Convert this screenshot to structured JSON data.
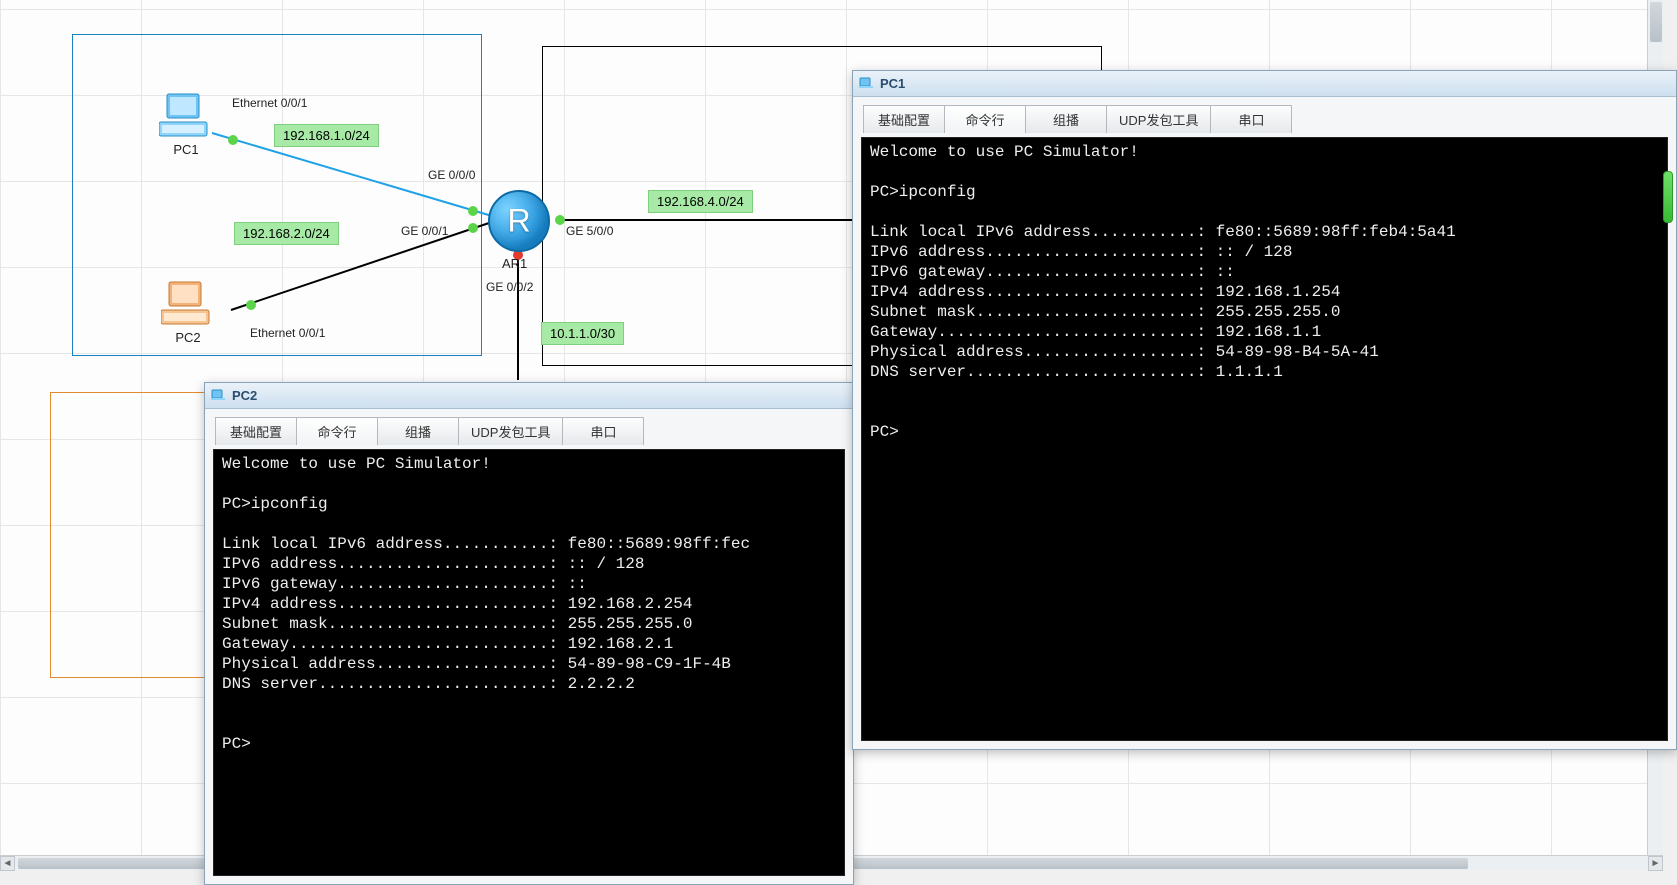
{
  "topology": {
    "devices": {
      "pc1": {
        "label": "PC1",
        "port": "Ethernet 0/0/1"
      },
      "pc2": {
        "label": "PC2",
        "port": "Ethernet 0/0/1"
      },
      "ar1": {
        "label": "AR1"
      }
    },
    "router_ports": {
      "ge000": "GE 0/0/0",
      "ge001": "GE 0/0/1",
      "ge002": "GE 0/0/2",
      "ge500": "GE 5/0/0"
    },
    "subnets": {
      "net1": "192.168.1.0/24",
      "net2": "192.168.2.0/24",
      "net4": "192.168.4.0/24",
      "net_p2p": "10.1.1.0/30"
    }
  },
  "tabs": {
    "basic": "基础配置",
    "cli": "命令行",
    "mcast": "组播",
    "udp": "UDP发包工具",
    "serial": "串口"
  },
  "pc1_window": {
    "title": "PC1",
    "terminal": {
      "welcome": "Welcome to use PC Simulator!",
      "prompt1": "PC>ipconfig",
      "line_linklocal": "Link local IPv6 address...........: fe80::5689:98ff:feb4:5a41",
      "line_v6addr": "IPv6 address......................: :: / 128",
      "line_v6gw": "IPv6 gateway......................: ::",
      "line_v4addr": "IPv4 address......................: 192.168.1.254",
      "line_mask": "Subnet mask.......................: 255.255.255.0",
      "line_gw": "Gateway...........................: 192.168.1.1",
      "line_mac": "Physical address..................: 54-89-98-B4-5A-41",
      "line_dns": "DNS server........................: 1.1.1.1",
      "prompt2": "PC>"
    }
  },
  "pc2_window": {
    "title": "PC2",
    "terminal": {
      "welcome": "Welcome to use PC Simulator!",
      "prompt1": "PC>ipconfig",
      "line_linklocal": "Link local IPv6 address...........: fe80::5689:98ff:fec",
      "line_v6addr": "IPv6 address......................: :: / 128",
      "line_v6gw": "IPv6 gateway......................: ::",
      "line_v4addr": "IPv4 address......................: 192.168.2.254",
      "line_mask": "Subnet mask.......................: 255.255.255.0",
      "line_gw": "Gateway...........................: 192.168.2.1",
      "line_mac": "Physical address..................: 54-89-98-C9-1F-4B",
      "line_dns": "DNS server........................: 2.2.2.2",
      "prompt2": "PC>"
    }
  }
}
